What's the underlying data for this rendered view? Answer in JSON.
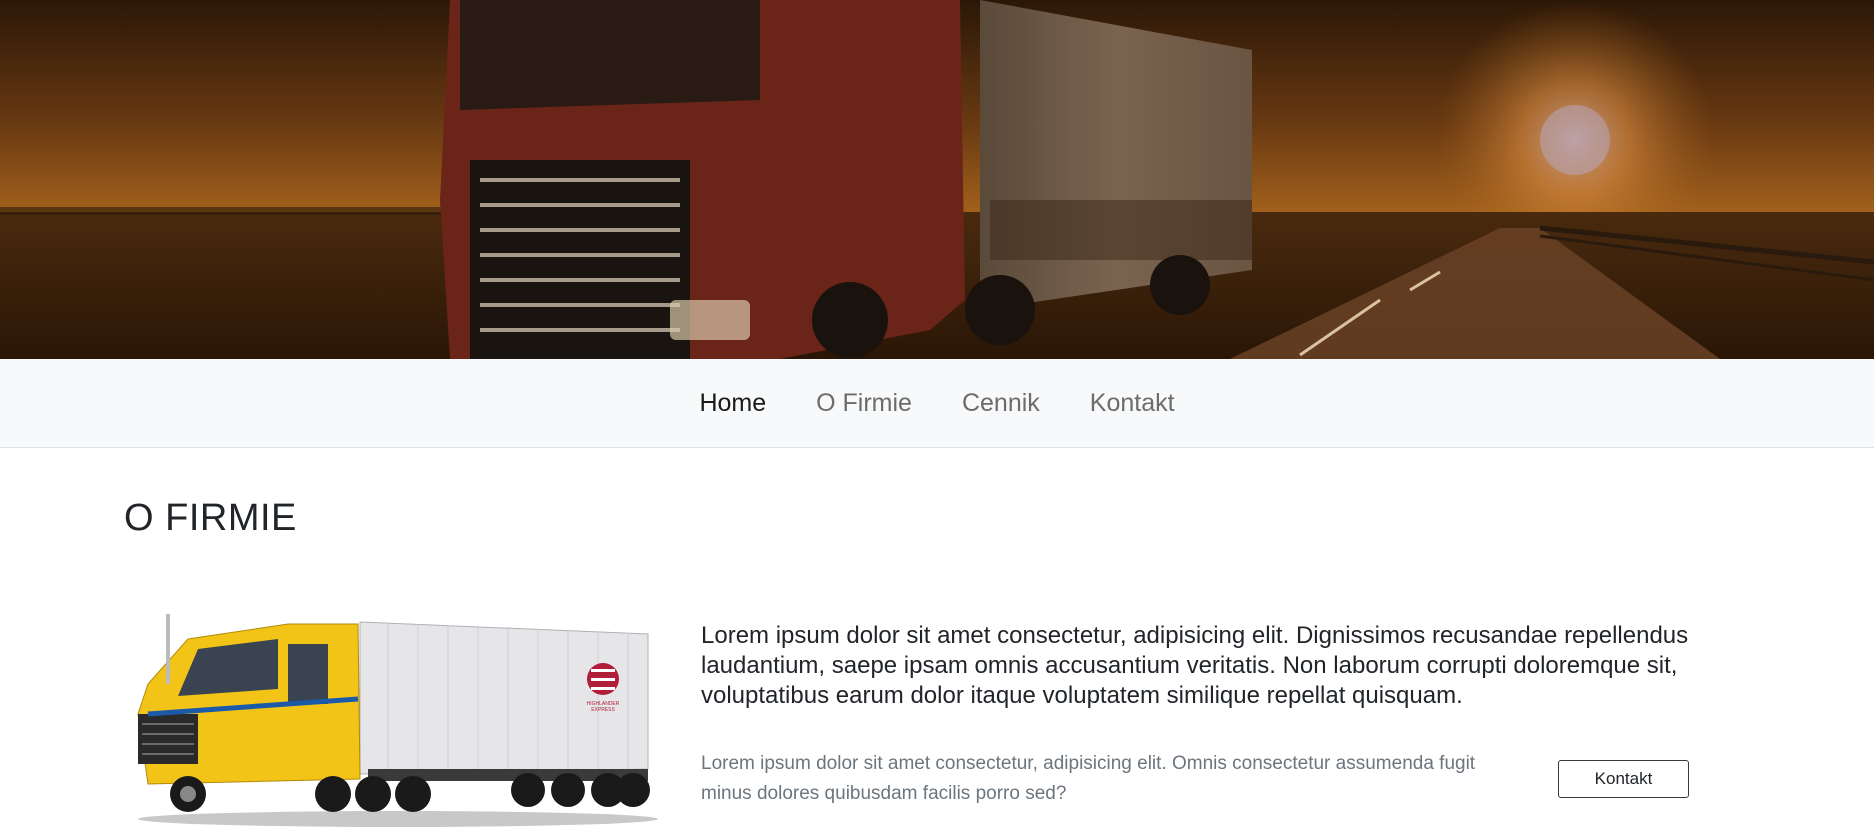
{
  "nav": {
    "items": [
      {
        "label": "Home",
        "active": true
      },
      {
        "label": "O Firmie",
        "active": false
      },
      {
        "label": "Cennik",
        "active": false
      },
      {
        "label": "Kontakt",
        "active": false
      }
    ]
  },
  "section": {
    "title": "O FIRMIE",
    "lead": "Lorem ipsum dolor sit amet consectetur, adipisicing elit. Dignissimos recusandae repellendus laudantium, saepe ipsam omnis accusantium veritatis. Non laborum corrupti doloremque sit, voluptatibus earum dolor itaque voluptatem similique repellat quisquam.",
    "muted": "Lorem ipsum dolor sit amet consectetur, adipisicing elit. Omnis consectetur assumenda fugit minus dolores quibusdam facilis porro sed?",
    "button_label": "Kontakt"
  },
  "truck_logo_text": [
    "HIGHLANDER",
    "EXPRESS"
  ],
  "colors": {
    "navbar_bg": "#f8f9fa",
    "nav_active": "#1a1a1a",
    "nav_inactive": "#6c6c6c",
    "muted_text": "#6c757d",
    "truck_cab": "#f2c417",
    "hero_sky": "#8a4e18"
  }
}
